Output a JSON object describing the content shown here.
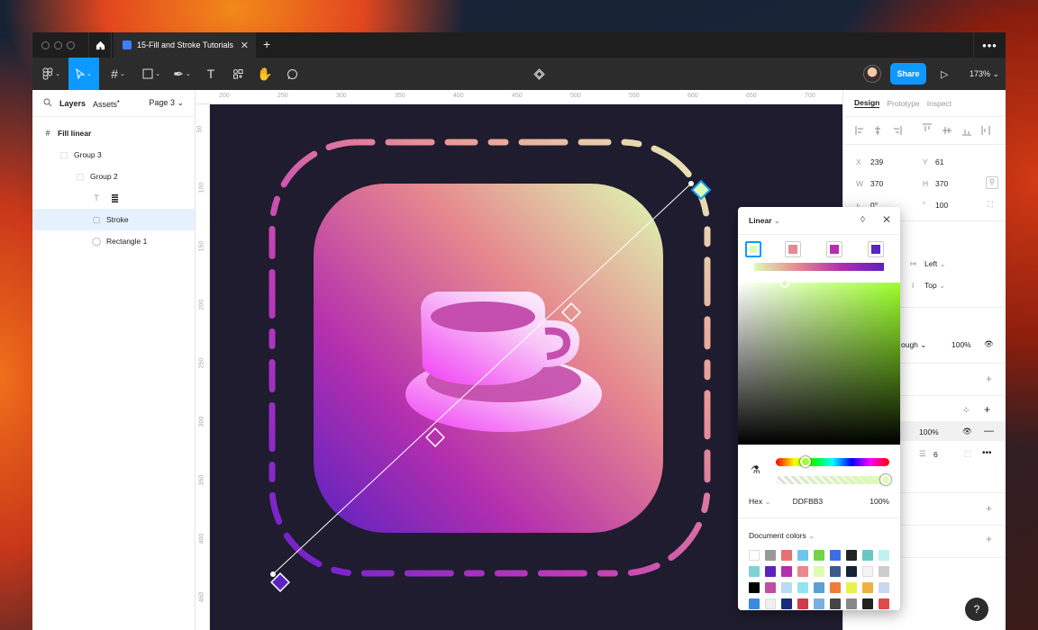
{
  "titlebar": {
    "tab_title": "15-Fill and Stroke Tutorials",
    "tab_close": "✕",
    "new_tab": "+",
    "more": "•••"
  },
  "toolbar": {
    "share": "Share",
    "zoom": "173% ⌄",
    "play": "▷"
  },
  "left_panel": {
    "tabs": [
      "Layers",
      "Assets"
    ],
    "page": "Page 3 ⌄",
    "layers": [
      {
        "name": "Fill linear",
        "icon": "#",
        "indent": 0,
        "bold": true
      },
      {
        "name": "Group 3",
        "icon": "⬚",
        "indent": 1
      },
      {
        "name": "Group 2",
        "icon": "⬚",
        "indent": 2
      },
      {
        "name": "",
        "icon": "T",
        "indent": 3
      },
      {
        "name": "Stroke",
        "icon": "▢",
        "indent": 3,
        "selected": true
      },
      {
        "name": "Rectangle 1",
        "icon": "◯",
        "indent": 3
      }
    ]
  },
  "rulers": {
    "top": [
      "200",
      "250",
      "300",
      "350",
      "400",
      "450",
      "500",
      "550",
      "600",
      "650",
      "700"
    ],
    "left": [
      "50",
      "100",
      "150",
      "200",
      "250",
      "300",
      "350",
      "400",
      "450"
    ]
  },
  "right_panel": {
    "tabs": [
      "Design",
      "Prototype",
      "Inspect"
    ],
    "x_label": "X",
    "x": "239",
    "y_label": "Y",
    "y": "61",
    "w_label": "W",
    "w": "370",
    "h_label": "H",
    "h": "370",
    "rotation": "0°",
    "radius": "100",
    "align_h": "Left",
    "align_v": "Top",
    "blend": "ough ⌄",
    "layer_opacity": "100%",
    "fill_opacity": "100%",
    "stroke_weight": "6",
    "plus": "+",
    "minus": "—"
  },
  "picker": {
    "type": "Linear",
    "hex_label": "Hex",
    "hex": "DDFBB3",
    "opacity": "100%",
    "doc_colors": "Document colors",
    "stops": [
      "#ddfbb3",
      "#e7898f",
      "#b32fae",
      "#5c22c2"
    ],
    "swatches": [
      "#ffffff",
      "#999999",
      "#e8716f",
      "#6ec6f0",
      "#72d44b",
      "#3b6fe0",
      "#222222",
      "#6cc6c8",
      "#bff0f2",
      "#7dd3d3",
      "#5b22c2",
      "#b32fae",
      "#e7898f",
      "#ddfbb3",
      "#3a5a8a",
      "#1a2238",
      "#f4f4f4",
      "#cccccc",
      "#000000",
      "#c04fa0",
      "#b8dcf2",
      "#8fe4f0",
      "#5aa0d0",
      "#f07a3a",
      "#e8f34a",
      "#f0b040",
      "#c8d8f0",
      "#3a8ae0",
      "#eeeeee",
      "#1a2a7a",
      "#d03a4a",
      "#7ab0e0",
      "#444444",
      "#888888",
      "#222222",
      "#e04a4a"
    ]
  }
}
